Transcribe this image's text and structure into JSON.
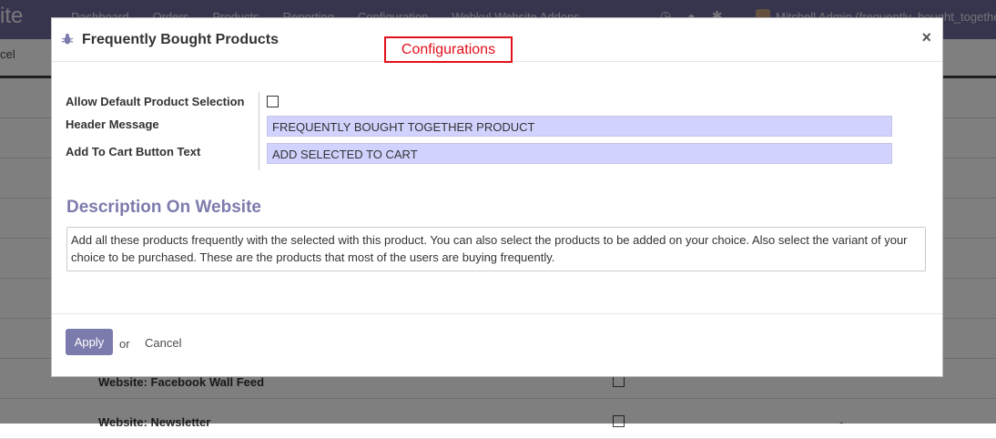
{
  "app": {
    "brand": "ite",
    "menu": [
      "Dashboard",
      "Orders",
      "Products",
      "Reporting",
      "Configuration",
      "Webkul Website Addons"
    ],
    "user": "Mitchell Admin (frequently_bought_togethe",
    "subbar_cancel": "cel"
  },
  "background_rows": [
    {
      "name": ""
    },
    {
      "name": ""
    },
    {
      "name": ""
    },
    {
      "name": ""
    },
    {
      "name": ""
    },
    {
      "name": ""
    },
    {
      "name": ""
    },
    {
      "name": "Website: Facebook Wall Feed",
      "dash": ""
    },
    {
      "name": "Website: Newsletter",
      "dash": "-"
    }
  ],
  "modal": {
    "title": "Frequently Bought Products",
    "close_label": "×",
    "annotation": "Configurations",
    "fields": {
      "allow_default_label": "Allow Default Product Selection",
      "allow_default_checked": false,
      "header_message_label": "Header Message",
      "header_message_value": "FREQUENTLY BOUGHT TOGETHER PRODUCT",
      "add_to_cart_label": "Add To Cart Button Text",
      "add_to_cart_value": "ADD SELECTED TO CART"
    },
    "section_title": "Description On Website",
    "description": "Add all these products frequently with the selected with this product. You can also select the products to be added on your choice. Also select the variant of your choice to be purchased. These are the products that most of the users are buying frequently.",
    "footer": {
      "apply_label": "Apply",
      "or_label": "or",
      "cancel_label": "Cancel"
    }
  },
  "colors": {
    "navbar": "#6e6a9a",
    "accent": "#7c7bad",
    "input_bg": "#d2d2ff",
    "annotation": "#e2101a"
  }
}
